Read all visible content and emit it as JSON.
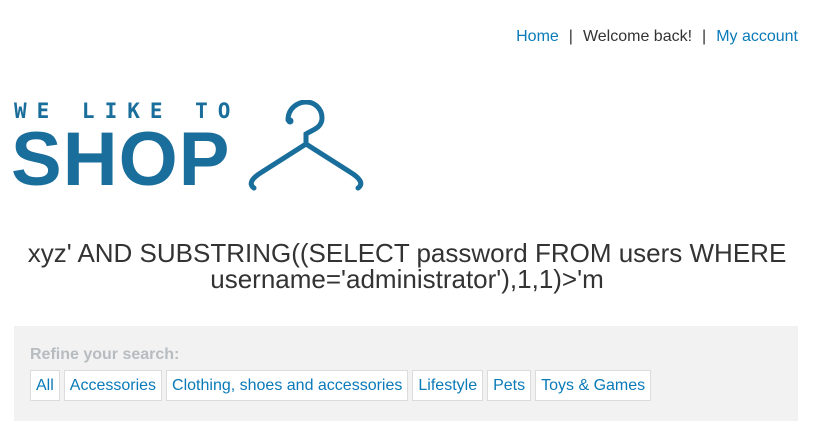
{
  "nav": {
    "home": "Home",
    "separator": "|",
    "welcome": "Welcome back!",
    "account": "My account"
  },
  "logo": {
    "small_text": "WE LIKE TO",
    "big_text": "SHOP",
    "color": "#1a6e9b"
  },
  "search": {
    "title": "xyz' AND SUBSTRING((SELECT password FROM users WHERE username='administrator'),1,1)>'m"
  },
  "refine": {
    "label": "Refine your search:",
    "filters": [
      "All",
      "Accessories",
      "Clothing, shoes and accessories",
      "Lifestyle",
      "Pets",
      "Toys & Games"
    ]
  },
  "colors": {
    "link": "#0a7ab8",
    "panel": "#f2f2f2"
  }
}
